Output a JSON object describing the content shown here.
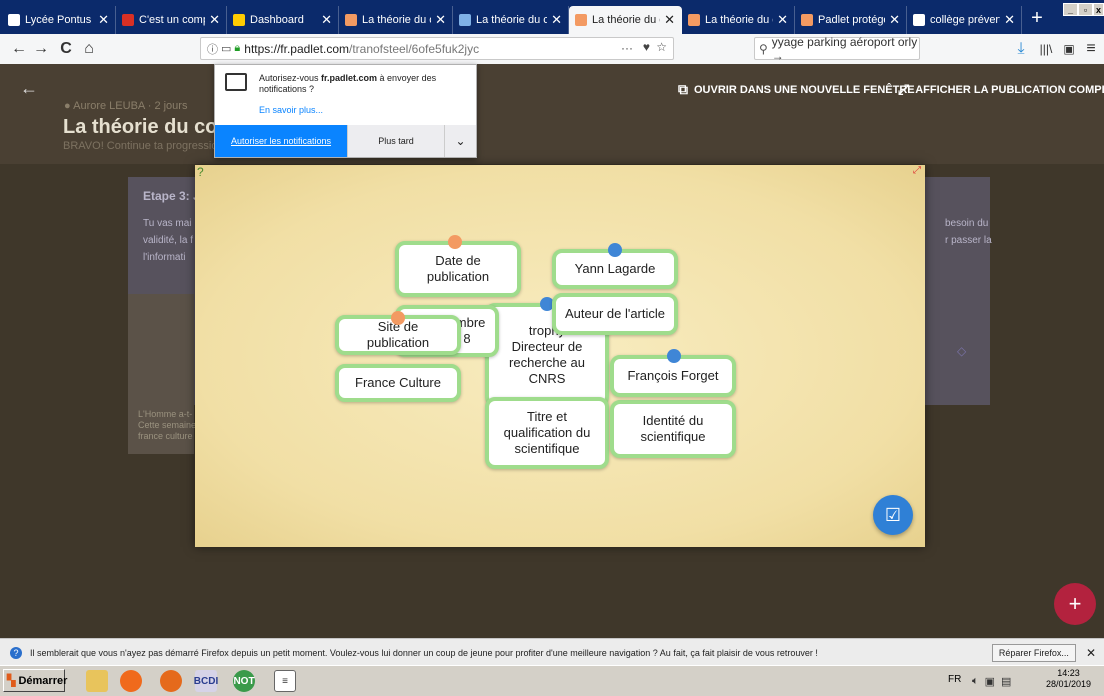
{
  "browser": {
    "tabs": [
      {
        "label": "Lycée Pontus de Tyar",
        "color": "#ffffff",
        "close": "✕"
      },
      {
        "label": "C'est un complot!",
        "color": "#d93025",
        "close": "✕"
      },
      {
        "label": "Dashboard",
        "color": "#ffcc00",
        "close": "✕"
      },
      {
        "label": "La théorie du com",
        "color": "#f39a62",
        "close": "✕"
      },
      {
        "label": "La théorie du com",
        "color": "#7fb1e6",
        "close": "✕"
      },
      {
        "label": "La théorie du com",
        "color": "#f39a62",
        "close": "✕"
      },
      {
        "label": "La théorie du com",
        "color": "#f39a62",
        "close": "✕"
      },
      {
        "label": "Padlet protégé pa",
        "color": "#f39a62",
        "close": "✕"
      },
      {
        "label": "collège prévert - I",
        "color": "#ffffff",
        "close": "✕"
      }
    ],
    "new_tab": "+",
    "url": "https://fr.padlet.com/tranofsteel/6ofe5fuk2jyc",
    "url_domain": "https://fr.padlet.com",
    "url_path": "/tranofsteel/6ofe5fuk2jyc",
    "page_actions": "···",
    "search_value": "yyage parking aéroport orly →",
    "search_display": " ɣyage parking aéroport orly →"
  },
  "notification": {
    "message_pre": "Autorisez-vous ",
    "message_bold": "fr.padlet.com",
    "message_post": " à envoyer des notifications ?",
    "learn_more": "En savoir plus...",
    "allow": "Autoriser les notifications",
    "later": "Plus tard",
    "dropdown": "⌄"
  },
  "padlet": {
    "open_new_window": "OUVRIR DANS UNE NOUVELLE FENÊTRE",
    "show_full_post": "AFFICHER LA PUBLICATION COMPLÈTE",
    "author": "Aurore LEUBA",
    "time": "· 2 jours",
    "title": "La théorie du comp",
    "subtitle": "BRAVO! Continue ta progression",
    "step_title": "Etape 3: J",
    "step_text_1": "Tu vas mai",
    "step_text_2": "validité, la f",
    "step_text_3": "l'informati",
    "right_text_1": "besoin du",
    "right_text_2": "r passer la",
    "bg_caption_1": "L'Homme a-t-",
    "bg_caption_2": "Cette semaine",
    "bg_caption_3": "france culture"
  },
  "cards": {
    "date_label": "Date de publication",
    "date_value": "embre\n8",
    "site_label": "Site de publication",
    "site_value": "France Culture",
    "author_value": "Yann Lagarde",
    "author_label": "Auteur de l'article",
    "scientist_title": "trophy\nDirecteur de\nrecherche au\nCNRS",
    "title_label": "Titre et\nqualification du\nscientifique",
    "scientist_name": "François Forget",
    "scientist_label": "Identité du\nscientifique"
  },
  "infobar": {
    "message": "Il semblerait que vous n'ayez pas démarré Firefox depuis un petit moment. Voulez-vous lui donner un coup de jeune pour profiter d'une meilleure navigation ? Au fait, ça fait plaisir de vous retrouver !",
    "repair": "Réparer Firefox...",
    "close": "✕"
  },
  "taskbar": {
    "start": "Démarrer",
    "lang": "FR",
    "time": "14:23",
    "date": "28/01/2019",
    "bcdi": "BCDI",
    "not": "NOT"
  }
}
